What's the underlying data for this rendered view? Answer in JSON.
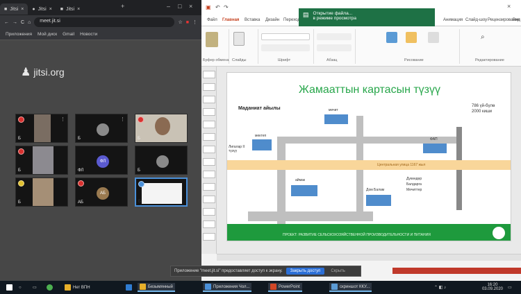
{
  "browser": {
    "tabs": [
      {
        "label": "Jitsi"
      },
      {
        "label": "Jitsi"
      },
      {
        "label": "Jitsi"
      }
    ],
    "url": "meet.jit.si",
    "bookmarks": [
      "Приложения",
      "Мой диск",
      "Gmail",
      "Новости"
    ],
    "logo": "jitsi.org"
  },
  "participants": [
    {
      "name": "Б"
    },
    {
      "name": "Б"
    },
    {
      "name": "Б"
    },
    {
      "name": "Б"
    },
    {
      "name": "ФЛ",
      "avatar": "ФЛ"
    },
    {
      "name": "Б"
    },
    {
      "name": "Б"
    },
    {
      "name": "АБ",
      "avatar": "АБ"
    },
    {
      "name": "Б"
    }
  ],
  "notification": {
    "text": "Приложение \"meet.jit.si\" предоставляет доступ к экрану.",
    "share_btn": "Закрыть доступ",
    "hide_btn": "Скрыть"
  },
  "ppt": {
    "ribbon_tabs": [
      "Файл",
      "Главная",
      "Вставка",
      "Дизайн",
      "Переходы",
      "Анимация",
      "Слайд-шоу",
      "Рецензирование",
      "Вид"
    ],
    "groups": [
      "Буфер обмена",
      "Слайды",
      "Шрифт",
      "Абзац",
      "Рисование",
      "Редактирование"
    ],
    "toast": {
      "line1": "Открытие файла...",
      "line2": "в режиме просмотра"
    },
    "slide": {
      "title": "Жамааттын картасын түзүү",
      "map_title": "Маданиат айылы",
      "legend": [
        "786 үй-бүлө",
        "2000 киши"
      ],
      "labels": [
        "мечит",
        "мектеп",
        "Лигалар II түзүү",
        "ФАП",
        "аймак",
        "Центральная улица 1167 жыл",
        "Дом Балам",
        "Дүкөндөр",
        "Балдарга",
        "Мечиттер"
      ],
      "footer": "ПРОЕКТ: РАЗВИТИЕ СЕЛЬСКОХОЗЯЙСТВЕННОЙ ПРОИЗВОДИТЕЛЬНОСТИ И ПИТАНИЯ"
    }
  },
  "taskbar": {
    "items": [
      "Нет ВПН",
      "Безымянный",
      "Приложения Чол...",
      "PowerPoint",
      "скриншот ККУ..."
    ],
    "time": "16:20",
    "date": "03.09.2020"
  }
}
